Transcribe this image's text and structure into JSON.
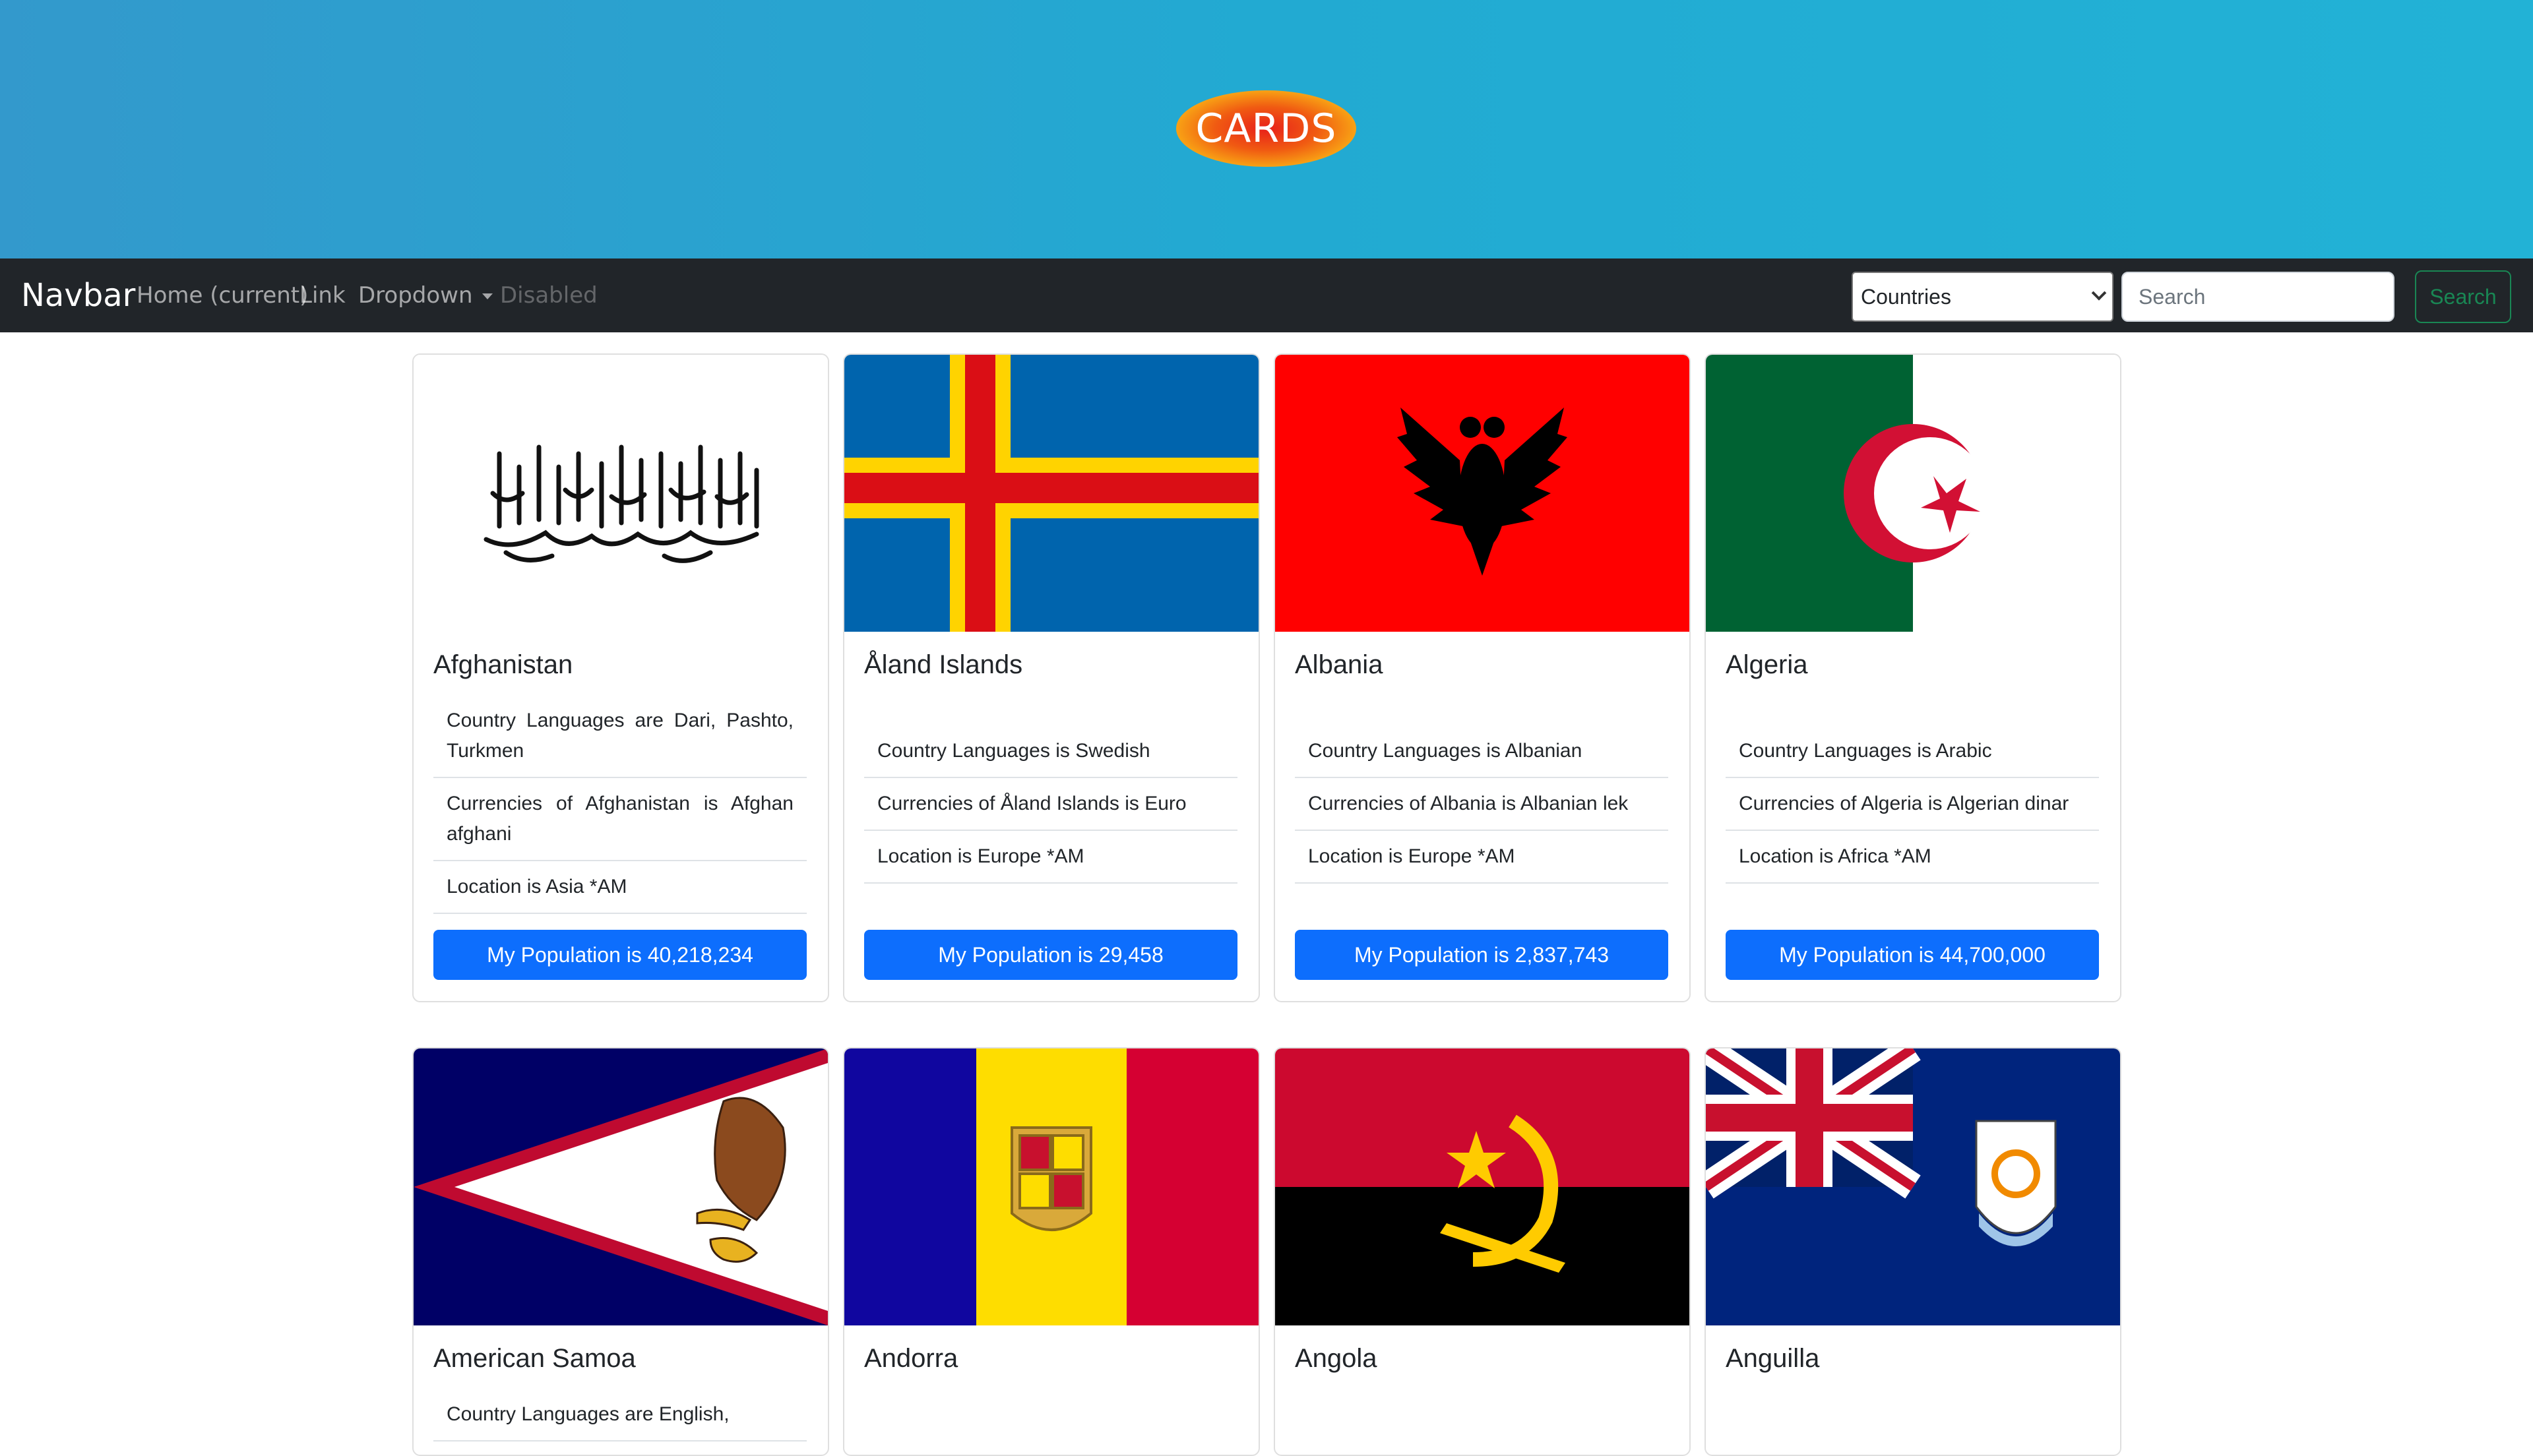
{
  "hero": {
    "logo_text": "CARDS"
  },
  "navbar": {
    "brand": "Navbar",
    "links": [
      "Home (current)",
      "Link",
      "Dropdown",
      "Disabled"
    ],
    "select_value": "Countries",
    "search_placeholder": "Search",
    "search_button": "Search"
  },
  "cards": [
    {
      "name": "Afghanistan",
      "languages": "Country Languages are Dari, Pashto, Turkmen",
      "currencies": "Currencies of Afghanistan is Afghan afghani",
      "location": "Location is Asia *AM",
      "population": "My Population is 40,218,234"
    },
    {
      "name": "Åland Islands",
      "languages": "Country Languages is Swedish",
      "currencies": "Currencies of Åland Islands is Euro",
      "location": "Location is Europe *AM",
      "population": "My Population is 29,458"
    },
    {
      "name": "Albania",
      "languages": "Country Languages is Albanian",
      "currencies": "Currencies of Albania is Albanian lek",
      "location": "Location is Europe *AM",
      "population": "My Population is 2,837,743"
    },
    {
      "name": "Algeria",
      "languages": "Country Languages is Arabic",
      "currencies": "Currencies of Algeria is Algerian dinar",
      "location": "Location is Africa *AM",
      "population": "My Population is 44,700,000"
    },
    {
      "name": "American Samoa",
      "languages": "Country Languages are English,"
    },
    {
      "name": "Andorra"
    },
    {
      "name": "Angola"
    },
    {
      "name": "Anguilla"
    }
  ],
  "colors": {
    "navbar_bg": "#212529",
    "primary_button": "#0d6efd",
    "success_outline": "#198754"
  }
}
